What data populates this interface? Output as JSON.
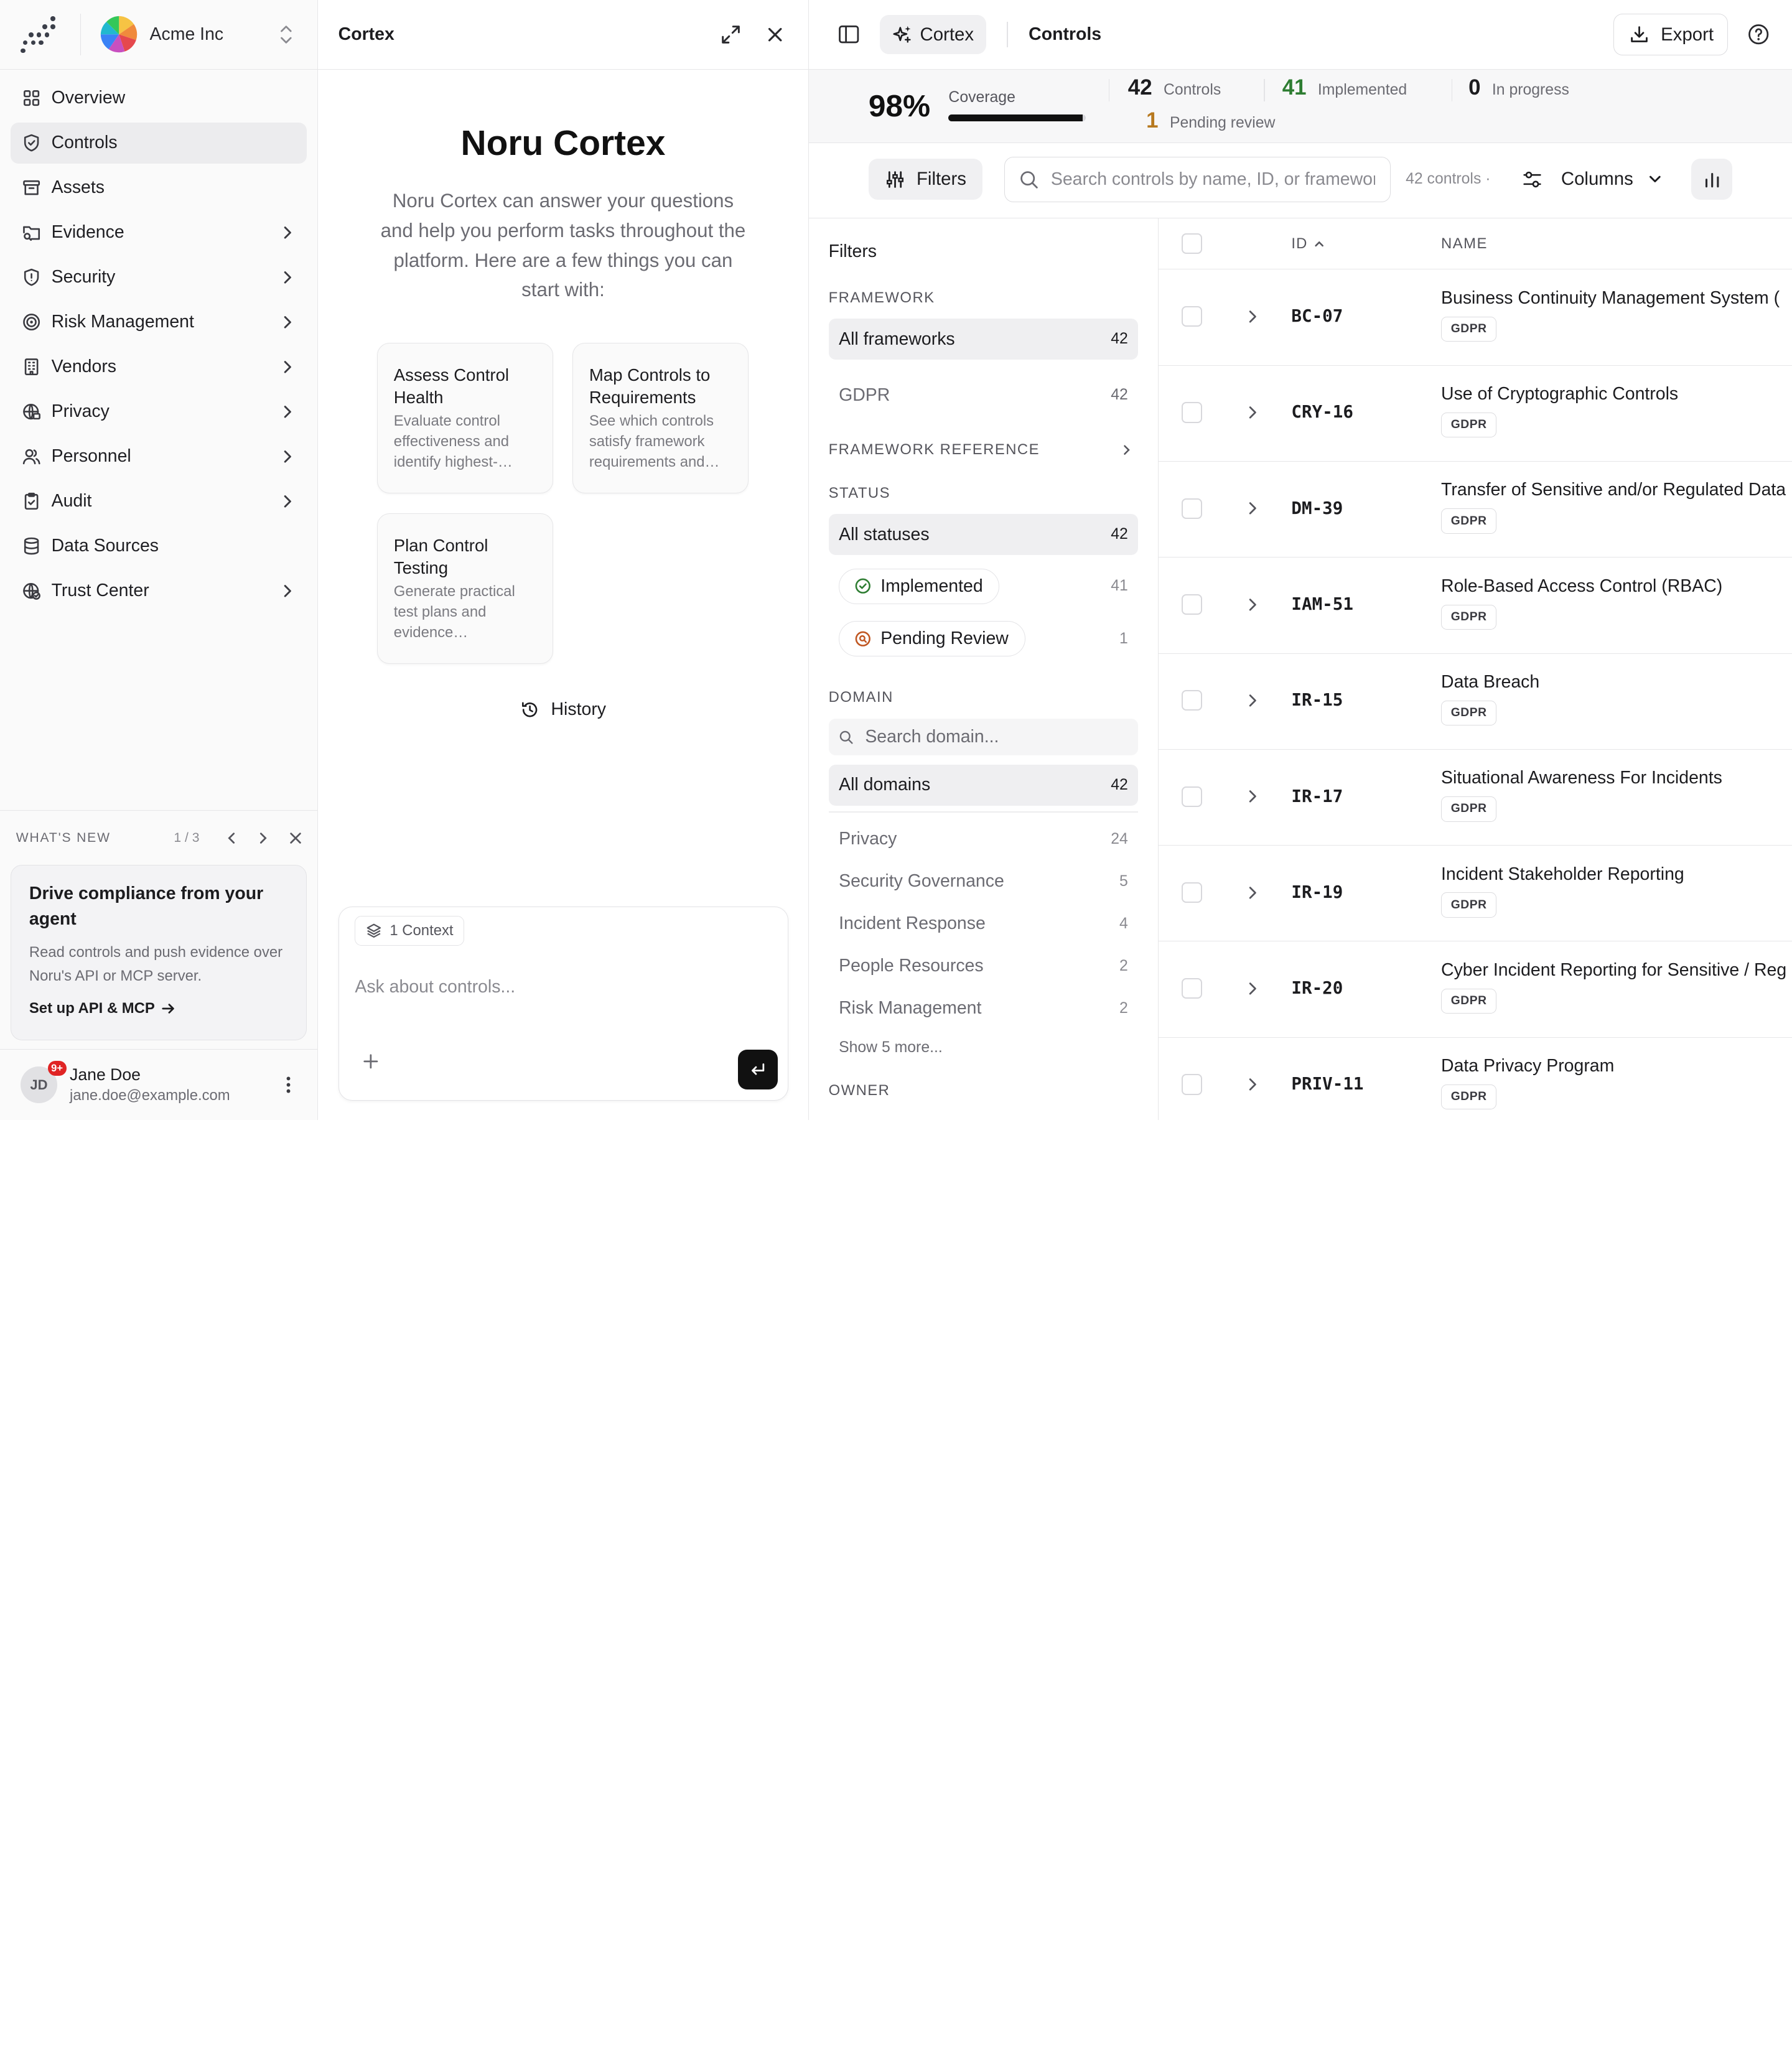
{
  "org": {
    "name": "Acme Inc"
  },
  "sidebar": {
    "items": [
      {
        "label": "Overview",
        "icon": "grid-icon",
        "chevron": false
      },
      {
        "label": "Controls",
        "icon": "shield-check-icon",
        "chevron": false,
        "active": true
      },
      {
        "label": "Assets",
        "icon": "archive-icon",
        "chevron": false
      },
      {
        "label": "Evidence",
        "icon": "folder-search-icon",
        "chevron": true
      },
      {
        "label": "Security",
        "icon": "shield-icon",
        "chevron": true
      },
      {
        "label": "Risk Management",
        "icon": "target-icon",
        "chevron": true
      },
      {
        "label": "Vendors",
        "icon": "building-icon",
        "chevron": true
      },
      {
        "label": "Privacy",
        "icon": "globe-lock-icon",
        "chevron": true
      },
      {
        "label": "Personnel",
        "icon": "users-icon",
        "chevron": true
      },
      {
        "label": "Audit",
        "icon": "clipboard-check-icon",
        "chevron": true
      },
      {
        "label": "Data Sources",
        "icon": "database-icon",
        "chevron": false
      },
      {
        "label": "Trust Center",
        "icon": "globe-check-icon",
        "chevron": true
      }
    ]
  },
  "whats_new": {
    "title": "WHAT'S NEW",
    "page": "1 / 3",
    "card_title": "Drive compliance from your agent",
    "card_body": "Read controls and push evidence over Noru's API or MCP server.",
    "link": "Set up API & MCP"
  },
  "user": {
    "initials": "JD",
    "badge": "9+",
    "name": "Jane Doe",
    "email": "jane.doe@example.com"
  },
  "cortex": {
    "header": "Cortex",
    "title": "Noru Cortex",
    "description": "Noru Cortex can answer your questions and help you perform tasks throughout the platform. Here are a few things you can start with:",
    "suggestions": [
      {
        "title": "Assess Control Health",
        "desc": "Evaluate control effectiveness and identify highest-…"
      },
      {
        "title": "Map Controls to Requirements",
        "desc": "See which controls satisfy framework requirements and…"
      },
      {
        "title": "Plan Control Testing",
        "desc": "Generate practical test plans and evidence…"
      }
    ],
    "history": "History",
    "context_chip": "1 Context",
    "input_placeholder": "Ask about controls..."
  },
  "controls": {
    "cortex_pill": "Cortex",
    "title": "Controls",
    "export": "Export",
    "coverage": {
      "pct": "98%",
      "label": "Coverage",
      "fraction": 0.98
    },
    "stats": {
      "controls": {
        "n": "42",
        "label": "Controls"
      },
      "implemented": {
        "n": "41",
        "label": "Implemented",
        "color": "#2e7d32"
      },
      "in_progress": {
        "n": "0",
        "label": "In progress"
      },
      "pending": {
        "n": "1",
        "label": "Pending review",
        "color": "#b7791f"
      }
    },
    "toolbar": {
      "filters": "Filters",
      "search_placeholder": "Search controls by name, ID, or framework",
      "count": "42 controls ·",
      "columns": "Columns"
    },
    "filter_pane": {
      "title": "Filters",
      "framework_label": "FRAMEWORK",
      "frameworks": [
        {
          "label": "All frameworks",
          "count": "42"
        },
        {
          "label": "GDPR",
          "count": "42"
        }
      ],
      "framework_reference": "FRAMEWORK REFERENCE",
      "status_label": "STATUS",
      "all_statuses": {
        "label": "All statuses",
        "count": "42"
      },
      "statuses": [
        {
          "label": "Implemented",
          "count": "41",
          "color": "#2e7d32"
        },
        {
          "label": "Pending Review",
          "count": "1",
          "color": "#c05621"
        }
      ],
      "domain_label": "DOMAIN",
      "domain_search_placeholder": "Search domain...",
      "all_domains": {
        "label": "All domains",
        "count": "42"
      },
      "domains": [
        {
          "label": "Privacy",
          "count": "24"
        },
        {
          "label": "Security Governance",
          "count": "5"
        },
        {
          "label": "Incident Response",
          "count": "4"
        },
        {
          "label": "People Resources",
          "count": "2"
        },
        {
          "label": "Risk Management",
          "count": "2"
        }
      ],
      "show_more": "Show 5 more...",
      "owner_label": "OWNER"
    },
    "table": {
      "col_id": "ID",
      "col_name": "NAME",
      "rows": [
        {
          "id": "BC-07",
          "name": "Business Continuity Management System (",
          "tag": "GDPR"
        },
        {
          "id": "CRY-16",
          "name": "Use of Cryptographic Controls",
          "tag": "GDPR"
        },
        {
          "id": "DM-39",
          "name": "Transfer of Sensitive and/or Regulated Data",
          "tag": "GDPR"
        },
        {
          "id": "IAM-51",
          "name": "Role-Based Access Control (RBAC)",
          "tag": "GDPR"
        },
        {
          "id": "IR-15",
          "name": "Data Breach",
          "tag": "GDPR"
        },
        {
          "id": "IR-17",
          "name": "Situational Awareness For Incidents",
          "tag": "GDPR"
        },
        {
          "id": "IR-19",
          "name": "Incident Stakeholder Reporting",
          "tag": "GDPR"
        },
        {
          "id": "IR-20",
          "name": "Cyber Incident Reporting for Sensitive / Reg",
          "tag": "GDPR"
        },
        {
          "id": "PRIV-11",
          "name": "Data Privacy Program",
          "tag": "GDPR"
        }
      ]
    }
  }
}
